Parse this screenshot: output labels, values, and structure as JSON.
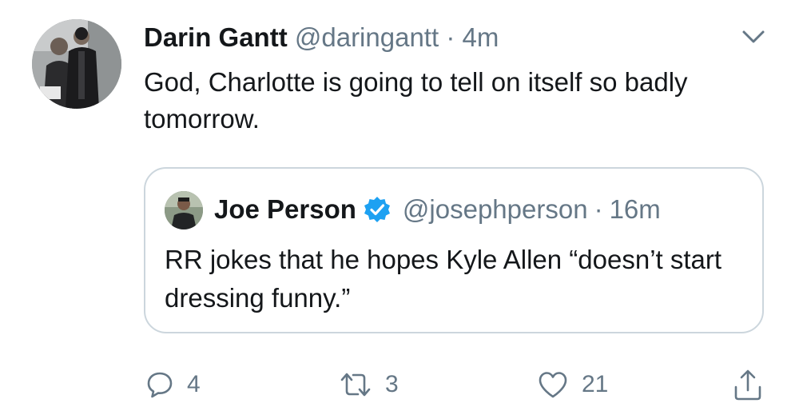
{
  "tweet": {
    "author": {
      "display_name": "Darin Gantt",
      "handle": "@daringantt",
      "avatar_icon": "profile-photo"
    },
    "separator": "·",
    "time": "4m",
    "text": "God, Charlotte is going to tell on itself so badly tomorrow.",
    "menu_icon": "chevron-down-icon"
  },
  "quoted_tweet": {
    "author": {
      "display_name": "Joe Person",
      "verified": true,
      "handle": "@josephperson",
      "avatar_icon": "profile-photo"
    },
    "separator": "·",
    "time": "16m",
    "text": "RR jokes that he hopes Kyle Allen “doesn’t start dressing funny.”"
  },
  "actions": {
    "reply": {
      "icon": "reply-icon",
      "count": "4"
    },
    "retweet": {
      "icon": "retweet-icon",
      "count": "3"
    },
    "like": {
      "icon": "heart-icon",
      "count": "21"
    },
    "share": {
      "icon": "share-icon"
    }
  },
  "colors": {
    "text": "#14171a",
    "secondary": "#657786",
    "border": "#ccd6dd",
    "verified": "#1da1f2"
  }
}
